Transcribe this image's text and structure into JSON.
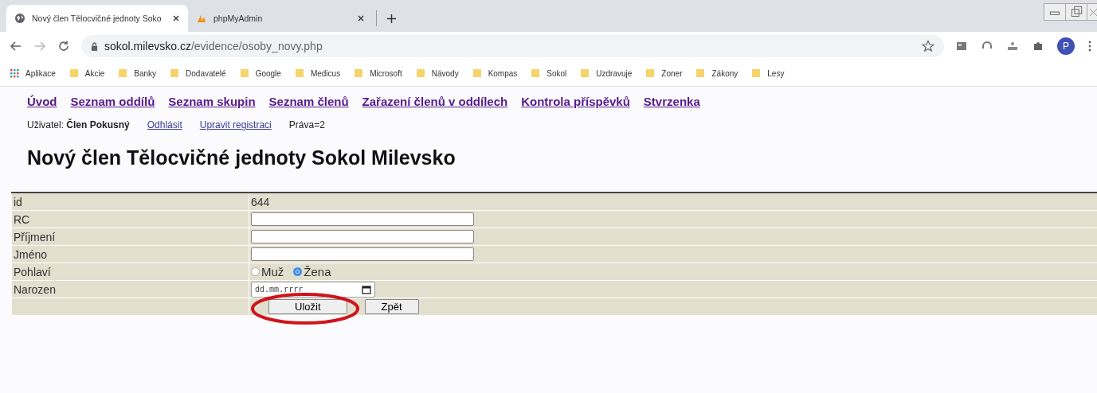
{
  "browser": {
    "tabs": [
      {
        "title": "Nový člen Tělocvičné jednoty Soko",
        "selected": true
      },
      {
        "title": "phpMyAdmin",
        "selected": false
      }
    ],
    "address": {
      "host": "sokol.milevsko.cz",
      "path": "/evidence/osoby_novy.php"
    },
    "profile_initial": "P",
    "bookmarks": [
      {
        "label": "Aplikace",
        "kind": "apps"
      },
      {
        "label": "Akcie",
        "kind": "folder"
      },
      {
        "label": "Banky",
        "kind": "folder"
      },
      {
        "label": "Dodavatelé",
        "kind": "folder"
      },
      {
        "label": "Google",
        "kind": "folder"
      },
      {
        "label": "Medicus",
        "kind": "folder"
      },
      {
        "label": "Microsoft",
        "kind": "folder"
      },
      {
        "label": "Návody",
        "kind": "folder"
      },
      {
        "label": "Kompas",
        "kind": "folder"
      },
      {
        "label": "Sokol",
        "kind": "folder"
      },
      {
        "label": "Uzdravuje",
        "kind": "folder"
      },
      {
        "label": "Zoner",
        "kind": "folder"
      },
      {
        "label": "Zákony",
        "kind": "folder"
      },
      {
        "label": "Lesy",
        "kind": "folder"
      }
    ]
  },
  "nav": [
    "Úvod",
    "Seznam oddílů",
    "Seznam skupin",
    "Seznam členů",
    "Zařazení členů v oddílech",
    "Kontrola příspěvků",
    "Stvrzenka"
  ],
  "user_bar": {
    "label": "Uživatel:",
    "name": "Člen Pokusný",
    "links": [
      "Odhlásit",
      "Upravit registraci"
    ],
    "rights": "Práva=2"
  },
  "heading": "Nový člen Tělocvičné jednoty Sokol Milevsko",
  "form": [
    {
      "label": "id",
      "kind": "text",
      "value": "644"
    },
    {
      "label": "RC",
      "kind": "input"
    },
    {
      "label": "Příjmení",
      "kind": "input"
    },
    {
      "label": "Jméno",
      "kind": "input"
    },
    {
      "label": "Pohlaví",
      "kind": "radio",
      "options": [
        {
          "label": "Muž",
          "selected": false
        },
        {
          "label": "Žena",
          "selected": true
        }
      ]
    },
    {
      "label": "Narozen",
      "kind": "date",
      "placeholder": "dd.mm.rrrr"
    },
    {
      "kind": "buttons",
      "buttons": [
        {
          "label": "Uložit",
          "circled": true
        },
        {
          "label": "Zpět",
          "circled": false
        }
      ]
    }
  ]
}
